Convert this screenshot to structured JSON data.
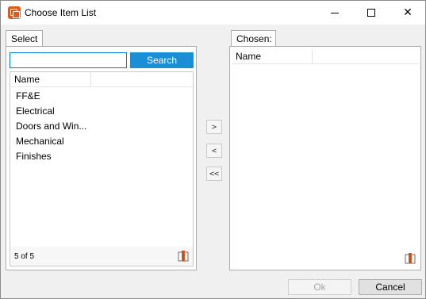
{
  "window": {
    "title": "Choose Item List",
    "controls": {
      "minimize": "minimize-icon",
      "maximize": "maximize-icon",
      "close": "close-icon"
    }
  },
  "select": {
    "tab_label": "Select",
    "search": {
      "value": "",
      "placeholder": "",
      "button_label": "Search"
    },
    "columns": [
      "Name"
    ],
    "items": [
      "FF&E",
      "Electrical",
      "Doors and Win...",
      "Mechanical",
      "Finishes"
    ],
    "count": "5 of 5"
  },
  "move_buttons": {
    "add": ">",
    "remove": "<",
    "remove_all": "<<"
  },
  "chosen": {
    "tab_label": "Chosen:",
    "columns": [
      "Name"
    ],
    "items": []
  },
  "footer": {
    "ok_label": "Ok",
    "cancel_label": "Cancel"
  },
  "colors": {
    "accent": "#1a8fd6",
    "app_icon": "#e05a1c"
  }
}
